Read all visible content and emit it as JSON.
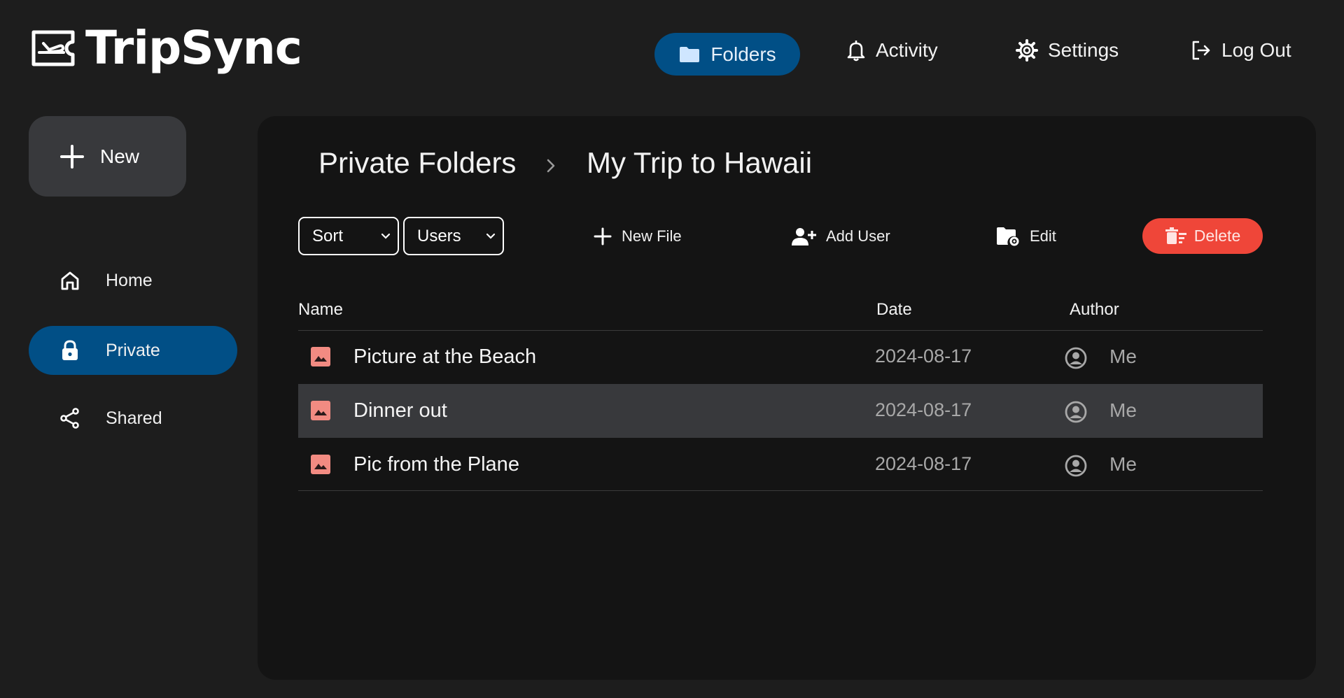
{
  "app": {
    "title": "TripSync"
  },
  "topnav": {
    "folders": "Folders",
    "activity": "Activity",
    "settings": "Settings",
    "logout": "Log Out"
  },
  "sidebar": {
    "new_label": "New",
    "items": [
      {
        "label": "Home",
        "icon": "home-icon"
      },
      {
        "label": "Private",
        "icon": "lock-icon",
        "active": true
      },
      {
        "label": "Shared",
        "icon": "share-icon"
      }
    ]
  },
  "breadcrumb": {
    "parent": "Private Folders",
    "separator": "›",
    "current": "My Trip to Hawaii"
  },
  "toolbar": {
    "sort_label": "Sort",
    "users_label": "Users",
    "new_file": "New File",
    "add_user": "Add User",
    "edit": "Edit",
    "delete": "Delete"
  },
  "table": {
    "columns": [
      "Name",
      "Date",
      "Author"
    ],
    "rows": [
      {
        "name": "Picture at the Beach",
        "date": "2024-08-17",
        "author": "Me",
        "selected": false
      },
      {
        "name": "Dinner out",
        "date": "2024-08-17",
        "author": "Me",
        "selected": true
      },
      {
        "name": "Pic from the Plane",
        "date": "2024-08-17",
        "author": "Me",
        "selected": false
      }
    ]
  },
  "colors": {
    "accent": "#014f86",
    "danger": "#ef4639",
    "file_icon": "#f28b82",
    "background": "#1d1d1d",
    "panel": "#141414"
  }
}
